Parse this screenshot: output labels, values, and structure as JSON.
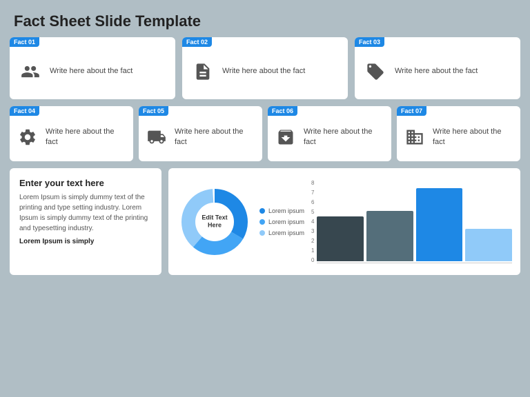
{
  "title": "Fact Sheet Slide Template",
  "colors": {
    "blue": "#1e88e5",
    "dark_blue": "#1565c0",
    "light_blue": "#90caf9",
    "lightest_blue": "#bbdefb",
    "mid_blue": "#42a5f5",
    "bar1": "#37474f",
    "bar2": "#546e7a",
    "bar3": "#1e88e5",
    "bar4": "#90caf9"
  },
  "row1": [
    {
      "id": "fact01",
      "label": "Fact 01",
      "text": "Write here about the fact",
      "icon": "people"
    },
    {
      "id": "fact02",
      "label": "Fact 02",
      "text": "Write here about the fact",
      "icon": "document"
    },
    {
      "id": "fact03",
      "label": "Fact 03",
      "text": "Write here about the fact",
      "icon": "tag"
    }
  ],
  "row2": [
    {
      "id": "fact04",
      "label": "Fact 04",
      "text": "Write here about the fact",
      "icon": "settings"
    },
    {
      "id": "fact05",
      "label": "Fact 05",
      "text": "Write here about the fact",
      "icon": "truck"
    },
    {
      "id": "fact06",
      "label": "Fact 06",
      "text": "Write here about the fact",
      "icon": "box"
    },
    {
      "id": "fact07",
      "label": "Fact 07",
      "text": "Write here about the fact",
      "icon": "building"
    }
  ],
  "text_section": {
    "title": "Enter your text here",
    "body": "Lorem Ipsum is simply dummy text of the printing and type setting industry. Lorem Ipsum is simply dummy text of the printing and typesetting industry.",
    "footer": "Lorem Ipsum is simply"
  },
  "donut": {
    "center_line1": "Edit Text",
    "center_line2": "Here",
    "legend": [
      {
        "label": "Lorem ipsum",
        "color": "#1e88e5"
      },
      {
        "label": "Lorem ipsum",
        "color": "#42a5f5"
      },
      {
        "label": "Lorem ipsum",
        "color": "#90caf9"
      }
    ]
  },
  "bar_chart": {
    "y_labels": [
      "0",
      "1",
      "2",
      "3",
      "4",
      "5",
      "6",
      "7",
      "8"
    ],
    "bars": [
      {
        "value": 55,
        "color": "#37474f"
      },
      {
        "value": 60,
        "color": "#546e7a"
      },
      {
        "value": 90,
        "color": "#1e88e5"
      },
      {
        "value": 40,
        "color": "#90caf9"
      }
    ]
  }
}
